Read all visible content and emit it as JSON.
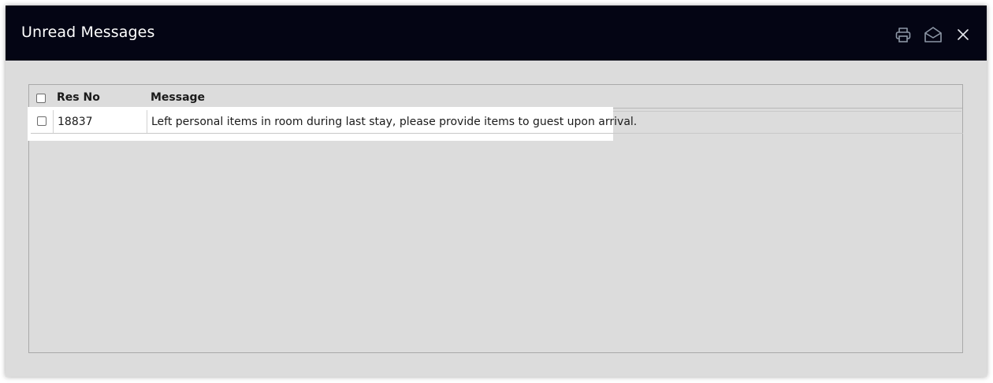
{
  "dialog": {
    "title": "Unread Messages",
    "actions": [
      {
        "name": "print",
        "icon": "printer-icon"
      },
      {
        "name": "mark-read",
        "icon": "envelope-open-icon"
      },
      {
        "name": "close",
        "icon": "close-icon"
      }
    ]
  },
  "grid": {
    "columns": [
      "Res No",
      "Message"
    ],
    "rows": [
      {
        "checked": false,
        "res_no": "18837",
        "message": "Left personal items in room during last stay, please provide items to guest upon arrival."
      }
    ]
  },
  "colors": {
    "titlebar": "#040514",
    "body": "#dcdcdc",
    "row_highlight": "#ffffff",
    "icon": "#8d97a6"
  }
}
